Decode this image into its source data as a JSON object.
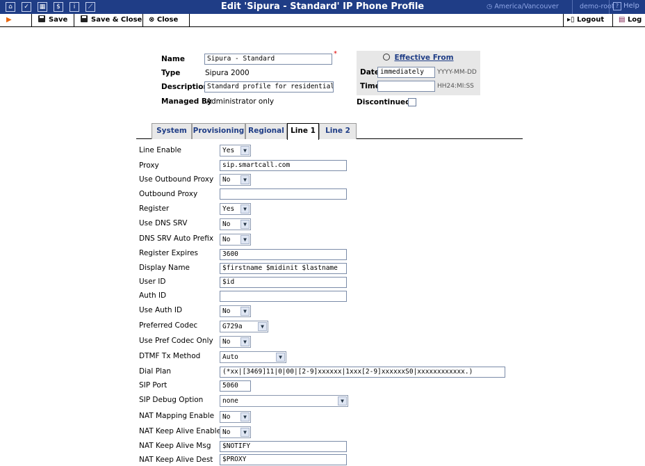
{
  "titlebar": {
    "title": "Edit 'Sipura - Standard' IP Phone Profile",
    "timezone": "America/Vancouver",
    "user": "demo-root",
    "help": "Help",
    "icons": [
      "home-icon",
      "check-icon",
      "grid-icon",
      "dollar-icon",
      "info-icon",
      "chart-icon"
    ]
  },
  "toolbar": {
    "save_label": "Save",
    "save_close_label": "Save & Close",
    "close_label": "Close",
    "logout_label": "Logout",
    "log_label": "Log"
  },
  "profile": {
    "name_label": "Name",
    "name_value": "Sipura - Standard",
    "type_label": "Type",
    "type_value": "Sipura 2000",
    "description_label": "Description",
    "description_value": "Standard profile for residential SIP",
    "managed_label": "Managed By",
    "managed_value": "Administrator only",
    "discontinued_label": "Discontinued"
  },
  "effective": {
    "title": "Effective From",
    "date_label": "Date",
    "date_value": "immediately",
    "date_hint": "YYYY-MM-DD",
    "time_label": "Time",
    "time_value": "",
    "time_hint": "HH24:MI:SS"
  },
  "tabs": [
    "System",
    "Provisioning",
    "Regional",
    "Line 1",
    "Line 2"
  ],
  "active_tab": "Line 1",
  "line1": [
    {
      "label": "Line Enable",
      "kind": "select",
      "value": "Yes"
    },
    {
      "label": "Proxy",
      "kind": "text",
      "value": "sip.smartcall.com"
    },
    {
      "label": "Use Outbound Proxy",
      "kind": "select",
      "value": "No"
    },
    {
      "label": "Outbound Proxy",
      "kind": "text",
      "value": ""
    },
    {
      "label": "Register",
      "kind": "select",
      "value": "Yes"
    },
    {
      "label": "Use DNS SRV",
      "kind": "select",
      "value": "No"
    },
    {
      "label": "DNS SRV Auto Prefix",
      "kind": "select",
      "value": "No"
    },
    {
      "label": "Register Expires",
      "kind": "text",
      "value": "3600"
    },
    {
      "label": "Display Name",
      "kind": "text",
      "value": "$firstname $midinit $lastname"
    },
    {
      "label": "User ID",
      "kind": "text",
      "value": "$id"
    },
    {
      "label": "Auth ID",
      "kind": "text",
      "value": ""
    },
    {
      "label": "Use Auth ID",
      "kind": "select",
      "value": "No"
    },
    {
      "label": "Preferred Codec",
      "kind": "select",
      "value": "G729a"
    },
    {
      "label": "Use Pref Codec Only",
      "kind": "select",
      "value": "No"
    },
    {
      "label": "DTMF Tx Method",
      "kind": "select",
      "value": "Auto"
    },
    {
      "label": "Dial Plan",
      "kind": "text",
      "value": "(*xx|[3469]11|0|00|[2-9]xxxxxx|1xxx[2-9]xxxxxxS0|xxxxxxxxxxxx.)"
    },
    {
      "label": "SIP Port",
      "kind": "text",
      "value": "5060"
    },
    {
      "label": "SIP Debug Option",
      "kind": "select",
      "value": "none"
    },
    {
      "label": "NAT Mapping Enable",
      "kind": "select",
      "value": "No"
    },
    {
      "label": "NAT Keep Alive Enable",
      "kind": "select",
      "value": "No"
    },
    {
      "label": "NAT Keep Alive Msg",
      "kind": "text",
      "value": "$NOTIFY"
    },
    {
      "label": "NAT Keep Alive Dest",
      "kind": "text",
      "value": "$PROXY"
    }
  ]
}
